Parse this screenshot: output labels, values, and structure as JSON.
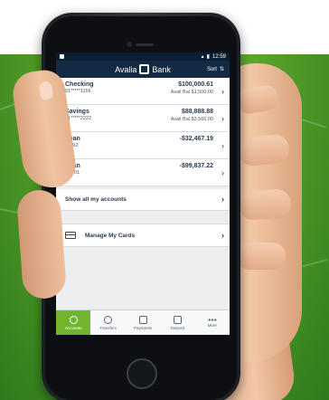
{
  "status": {
    "time": "12:59"
  },
  "app": {
    "brand_part1": "Avalia",
    "brand_part2": "Bank",
    "sort_label": "Sort"
  },
  "accounts": [
    {
      "name": "Checking",
      "number": "91*****1156",
      "balance": "$100,000.61",
      "available": "Avail Bal $1,500.00"
    },
    {
      "name": "Savings",
      "number": "81*****2222",
      "balance": "$88,888.88",
      "available": "Avail Bal $3,566.00"
    },
    {
      "name": "Loan",
      "number": "*7892",
      "balance": "-$32,467.19",
      "available": ""
    },
    {
      "name": "Loan",
      "number": "*95-01",
      "balance": "-$99,837.22",
      "available": ""
    }
  ],
  "show_all_label": "Show all my accounts",
  "manage_cards_label": "Manage My Cards",
  "tabs": [
    {
      "label": "Accounts",
      "icon": "dollar-icon",
      "active": true
    },
    {
      "label": "Transfers",
      "icon": "transfer-icon",
      "active": false
    },
    {
      "label": "Payments",
      "icon": "payments-icon",
      "active": false
    },
    {
      "label": "Deposit",
      "icon": "deposit-icon",
      "active": false
    },
    {
      "label": "More",
      "icon": "more-dots-icon",
      "active": false
    }
  ],
  "colors": {
    "appbar": "#132a44",
    "accent": "#71b52f",
    "background_green": "#5aa42a"
  }
}
